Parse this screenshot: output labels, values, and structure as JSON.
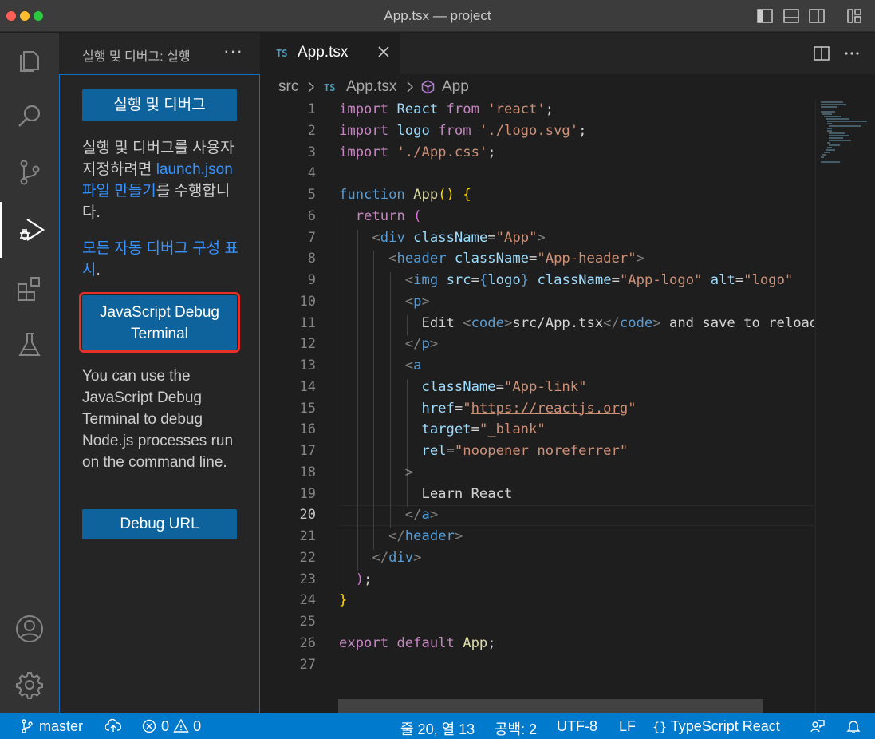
{
  "window": {
    "title": "App.tsx — project"
  },
  "activity_bar": {
    "items": [
      {
        "name": "explorer-icon"
      },
      {
        "name": "search-icon"
      },
      {
        "name": "source-control-icon"
      },
      {
        "name": "run-debug-icon",
        "active": true
      },
      {
        "name": "extensions-icon"
      },
      {
        "name": "testing-icon"
      },
      {
        "name": "account-icon"
      },
      {
        "name": "settings-gear-icon"
      }
    ]
  },
  "sidebar": {
    "title": "실행 및 디버그: 실행",
    "more": "···",
    "run_button": "실행 및 디버그",
    "text1_pre": "실행 및 디버그를 사용자 지정하려면 ",
    "text1_link": "launch.json 파일 만들기",
    "text1_post": "를 수행합니다.",
    "text2_link": "모든 자동 디버그 구성 표시",
    "text2_post": ".",
    "js_debug_button_line1": "JavaScript Debug",
    "js_debug_button_line2": "Terminal",
    "text3": "You can use the JavaScript Debug Terminal to debug Node.js processes run on the command line.",
    "debug_url_button": "Debug URL"
  },
  "tabs": [
    {
      "badge": "TS",
      "label": "App.tsx",
      "active": true
    }
  ],
  "breadcrumb": {
    "folder": "src",
    "file_badge": "TS",
    "file": "App.tsx",
    "symbol": "App"
  },
  "editor": {
    "active_line": 20,
    "line_numbers": [
      "1",
      "2",
      "3",
      "4",
      "5",
      "6",
      "7",
      "8",
      "9",
      "10",
      "11",
      "12",
      "13",
      "14",
      "15",
      "16",
      "17",
      "18",
      "19",
      "20",
      "21",
      "22",
      "23",
      "24",
      "25",
      "26",
      "27"
    ],
    "lines": [
      [
        [
          "kw",
          "import "
        ],
        [
          "vr",
          "React "
        ],
        [
          "kw",
          "from "
        ],
        [
          "st",
          "'react'"
        ],
        [
          "",
          "; "
        ]
      ],
      [
        [
          "kw",
          "import "
        ],
        [
          "vr",
          "logo "
        ],
        [
          "kw",
          "from "
        ],
        [
          "st",
          "'./logo.svg'"
        ],
        [
          "",
          ";"
        ]
      ],
      [
        [
          "kw",
          "import "
        ],
        [
          "st",
          "'./App.css'"
        ],
        [
          "",
          ";"
        ]
      ],
      [],
      [
        [
          "kb",
          "function "
        ],
        [
          "fn",
          "App"
        ],
        [
          "br",
          "() {"
        ]
      ],
      [
        [
          "",
          "  "
        ],
        [
          "kw",
          "return "
        ],
        [
          "bp",
          "("
        ]
      ],
      [
        [
          "",
          "    "
        ],
        [
          "pt",
          "<"
        ],
        [
          "tg",
          "div "
        ],
        [
          "at",
          "className"
        ],
        [
          "",
          "="
        ],
        [
          "st",
          "\"App\""
        ],
        [
          "pt",
          ">"
        ]
      ],
      [
        [
          "",
          "      "
        ],
        [
          "pt",
          "<"
        ],
        [
          "tg",
          "header "
        ],
        [
          "at",
          "className"
        ],
        [
          "",
          "="
        ],
        [
          "st",
          "\"App-header\""
        ],
        [
          "pt",
          ">"
        ]
      ],
      [
        [
          "",
          "        "
        ],
        [
          "pt",
          "<"
        ],
        [
          "tg",
          "img "
        ],
        [
          "at",
          "src"
        ],
        [
          "",
          "="
        ],
        [
          "kb",
          "{"
        ],
        [
          "vr",
          "logo"
        ],
        [
          "kb",
          "} "
        ],
        [
          "at",
          "className"
        ],
        [
          "",
          "="
        ],
        [
          "st",
          "\"App-logo\" "
        ],
        [
          "at",
          "alt"
        ],
        [
          "",
          "="
        ],
        [
          "st",
          "\"logo\""
        ]
      ],
      [
        [
          "",
          "        "
        ],
        [
          "pt",
          "<"
        ],
        [
          "tg",
          "p"
        ],
        [
          "pt",
          ">"
        ]
      ],
      [
        [
          "",
          "          Edit "
        ],
        [
          "pt",
          "<"
        ],
        [
          "tg",
          "code"
        ],
        [
          "pt",
          ">"
        ],
        [
          "",
          "src/App.tsx"
        ],
        [
          "pt",
          "</"
        ],
        [
          "tg",
          "code"
        ],
        [
          "pt",
          "> "
        ],
        [
          "",
          "and save to reload."
        ]
      ],
      [
        [
          "",
          "        "
        ],
        [
          "pt",
          "</"
        ],
        [
          "tg",
          "p"
        ],
        [
          "pt",
          ">"
        ]
      ],
      [
        [
          "",
          "        "
        ],
        [
          "pt",
          "<"
        ],
        [
          "tg",
          "a"
        ]
      ],
      [
        [
          "",
          "          "
        ],
        [
          "at",
          "className"
        ],
        [
          "",
          "="
        ],
        [
          "st",
          "\"App-link\""
        ]
      ],
      [
        [
          "",
          "          "
        ],
        [
          "at",
          "href"
        ],
        [
          "",
          "="
        ],
        [
          "st",
          "\""
        ],
        [
          "st ul",
          "https://reactjs.org"
        ],
        [
          "st",
          "\""
        ]
      ],
      [
        [
          "",
          "          "
        ],
        [
          "at",
          "target"
        ],
        [
          "",
          "="
        ],
        [
          "st",
          "\"_blank\""
        ]
      ],
      [
        [
          "",
          "          "
        ],
        [
          "at",
          "rel"
        ],
        [
          "",
          "="
        ],
        [
          "st",
          "\"noopener noreferrer\""
        ]
      ],
      [
        [
          "",
          "        "
        ],
        [
          "pt",
          ">"
        ]
      ],
      [
        [
          "",
          "          Learn React"
        ]
      ],
      [
        [
          "",
          "        "
        ],
        [
          "pt",
          "</"
        ],
        [
          "tg",
          "a"
        ],
        [
          "pt",
          ">"
        ]
      ],
      [
        [
          "",
          "      "
        ],
        [
          "pt",
          "</"
        ],
        [
          "tg",
          "header"
        ],
        [
          "pt",
          ">"
        ]
      ],
      [
        [
          "",
          "    "
        ],
        [
          "pt",
          "</"
        ],
        [
          "tg",
          "div"
        ],
        [
          "pt",
          ">"
        ]
      ],
      [
        [
          "",
          "  "
        ],
        [
          "bp",
          ")"
        ],
        [
          "",
          ";"
        ]
      ],
      [
        [
          "br",
          "}"
        ]
      ],
      [],
      [
        [
          "kw",
          "export "
        ],
        [
          "kw",
          "default "
        ],
        [
          "fn",
          "App"
        ],
        [
          "",
          ";"
        ]
      ],
      []
    ]
  },
  "statusbar": {
    "branch": "master",
    "errors": "0",
    "warnings": "0",
    "position": "줄 20, 열 13",
    "spaces": "공백: 2",
    "encoding": "UTF-8",
    "eol": "LF",
    "language": "TypeScript React"
  }
}
